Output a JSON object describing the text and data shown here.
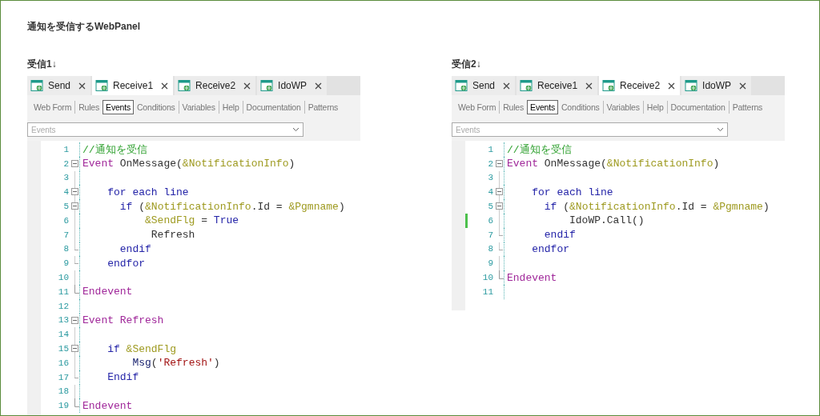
{
  "title": "通知を受信するWebPanel",
  "panels": [
    {
      "heading": "受信1↓",
      "tabs": [
        {
          "label": "Send",
          "selected": false
        },
        {
          "label": "Receive1",
          "selected": true
        },
        {
          "label": "Receive2",
          "selected": false
        },
        {
          "label": "IdoWP",
          "selected": false
        }
      ],
      "view_tabs": [
        {
          "label": "Web Form",
          "selected": false
        },
        {
          "label": "Rules",
          "selected": false
        },
        {
          "label": "Events",
          "selected": true
        },
        {
          "label": "Conditions",
          "selected": false
        },
        {
          "label": "Variables",
          "selected": false
        },
        {
          "label": "Help",
          "selected": false
        },
        {
          "label": "Documentation",
          "selected": false
        },
        {
          "label": "Patterns",
          "selected": false
        }
      ],
      "dropdown": {
        "placeholder": "Events"
      },
      "lines": [
        {
          "number": "1",
          "kind": "plain",
          "changed": false,
          "tokens": [
            {
              "kind": "comment",
              "text": "//通知を受信"
            }
          ]
        },
        {
          "number": "2",
          "kind": "opener",
          "changed": false,
          "tokens": [
            {
              "kind": "event",
              "text": "Event "
            },
            {
              "kind": "plain",
              "text": "OnMessage("
            },
            {
              "kind": "variable",
              "text": "&NotificationInfo"
            },
            {
              "kind": "plain",
              "text": ")"
            }
          ]
        },
        {
          "number": "3",
          "kind": "plain",
          "changed": false
        },
        {
          "number": "4",
          "kind": "opener",
          "changed": false,
          "tokens": [
            {
              "kind": "keyword",
              "text": "    for each line"
            }
          ]
        },
        {
          "number": "5",
          "kind": "opener",
          "changed": false,
          "tokens": [
            {
              "kind": "keyword",
              "text": "      if "
            },
            {
              "kind": "plain",
              "text": "("
            },
            {
              "kind": "variable",
              "text": "&NotificationInfo"
            },
            {
              "kind": "plain",
              "text": ".Id = "
            },
            {
              "kind": "variable",
              "text": "&Pgmname"
            },
            {
              "kind": "plain",
              "text": ")"
            }
          ]
        },
        {
          "number": "6",
          "kind": "plain",
          "changed": false,
          "tokens": [
            {
              "kind": "variable",
              "text": "          &SendFlg"
            },
            {
              "kind": "plain",
              "text": " = "
            },
            {
              "kind": "keyword",
              "text": "True"
            }
          ]
        },
        {
          "number": "7",
          "kind": "plain",
          "changed": false,
          "tokens": [
            {
              "kind": "plain",
              "text": "           Refresh"
            }
          ]
        },
        {
          "number": "8",
          "kind": "ender",
          "changed": false,
          "tokens": [
            {
              "kind": "keyword",
              "text": "      endif"
            }
          ]
        },
        {
          "number": "9",
          "kind": "ender",
          "changed": false,
          "tokens": [
            {
              "kind": "keyword",
              "text": "    endfor"
            }
          ]
        },
        {
          "number": "10",
          "kind": "plain",
          "changed": false
        },
        {
          "number": "11",
          "kind": "closer",
          "changed": false,
          "tokens": [
            {
              "kind": "event",
              "text": "Endevent"
            }
          ]
        },
        {
          "number": "12",
          "kind": "plain",
          "changed": false
        },
        {
          "number": "13",
          "kind": "opener",
          "changed": false,
          "tokens": [
            {
              "kind": "event",
              "text": "Event Refresh"
            }
          ]
        },
        {
          "number": "14",
          "kind": "plain",
          "changed": false
        },
        {
          "number": "15",
          "kind": "opener",
          "changed": false,
          "tokens": [
            {
              "kind": "keyword",
              "text": "    if "
            },
            {
              "kind": "variable",
              "text": "&SendFlg"
            }
          ]
        },
        {
          "number": "16",
          "kind": "plain",
          "changed": false,
          "tokens": [
            {
              "kind": "function",
              "text": "        Msg"
            },
            {
              "kind": "plain",
              "text": "("
            },
            {
              "kind": "string",
              "text": "'Refresh'"
            },
            {
              "kind": "plain",
              "text": ")"
            }
          ]
        },
        {
          "number": "17",
          "kind": "ender",
          "changed": false,
          "tokens": [
            {
              "kind": "keyword",
              "text": "    Endif"
            }
          ]
        },
        {
          "number": "18",
          "kind": "plain",
          "changed": false
        },
        {
          "number": "19",
          "kind": "closer",
          "changed": false,
          "tokens": [
            {
              "kind": "event",
              "text": "Endevent"
            }
          ]
        }
      ]
    },
    {
      "heading": "受信2↓",
      "tabs": [
        {
          "label": "Send",
          "selected": false
        },
        {
          "label": "Receive1",
          "selected": false
        },
        {
          "label": "Receive2",
          "selected": true
        },
        {
          "label": "IdoWP",
          "selected": false
        }
      ],
      "view_tabs": [
        {
          "label": "Web Form",
          "selected": false
        },
        {
          "label": "Rules",
          "selected": false
        },
        {
          "label": "Events",
          "selected": true
        },
        {
          "label": "Conditions",
          "selected": false
        },
        {
          "label": "Variables",
          "selected": false
        },
        {
          "label": "Help",
          "selected": false
        },
        {
          "label": "Documentation",
          "selected": false
        },
        {
          "label": "Patterns",
          "selected": false
        }
      ],
      "dropdown": {
        "placeholder": "Events"
      },
      "lines": [
        {
          "number": "1",
          "kind": "plain",
          "changed": false,
          "tokens": [
            {
              "kind": "comment",
              "text": "//通知を受信"
            }
          ]
        },
        {
          "number": "2",
          "kind": "opener",
          "changed": false,
          "tokens": [
            {
              "kind": "event",
              "text": "Event "
            },
            {
              "kind": "plain",
              "text": "OnMessage("
            },
            {
              "kind": "variable",
              "text": "&NotificationInfo"
            },
            {
              "kind": "plain",
              "text": ")"
            }
          ]
        },
        {
          "number": "3",
          "kind": "plain",
          "changed": false
        },
        {
          "number": "4",
          "kind": "opener",
          "changed": false,
          "tokens": [
            {
              "kind": "keyword",
              "text": "    for each line"
            }
          ]
        },
        {
          "number": "5",
          "kind": "opener",
          "changed": false,
          "tokens": [
            {
              "kind": "keyword",
              "text": "      if "
            },
            {
              "kind": "plain",
              "text": "("
            },
            {
              "kind": "variable",
              "text": "&NotificationInfo"
            },
            {
              "kind": "plain",
              "text": ".Id = "
            },
            {
              "kind": "variable",
              "text": "&Pgmname"
            },
            {
              "kind": "plain",
              "text": ")"
            }
          ]
        },
        {
          "number": "6",
          "kind": "plain",
          "changed": true,
          "tokens": [
            {
              "kind": "plain",
              "text": "          IdoWP.Call()"
            }
          ]
        },
        {
          "number": "7",
          "kind": "ender",
          "changed": false,
          "tokens": [
            {
              "kind": "keyword",
              "text": "      endif"
            }
          ]
        },
        {
          "number": "8",
          "kind": "ender",
          "changed": false,
          "tokens": [
            {
              "kind": "keyword",
              "text": "    endfor"
            }
          ]
        },
        {
          "number": "9",
          "kind": "plain",
          "changed": false
        },
        {
          "number": "10",
          "kind": "closer",
          "changed": false,
          "tokens": [
            {
              "kind": "event",
              "text": "Endevent"
            }
          ]
        },
        {
          "number": "11",
          "kind": "plain",
          "changed": false
        }
      ]
    }
  ]
}
